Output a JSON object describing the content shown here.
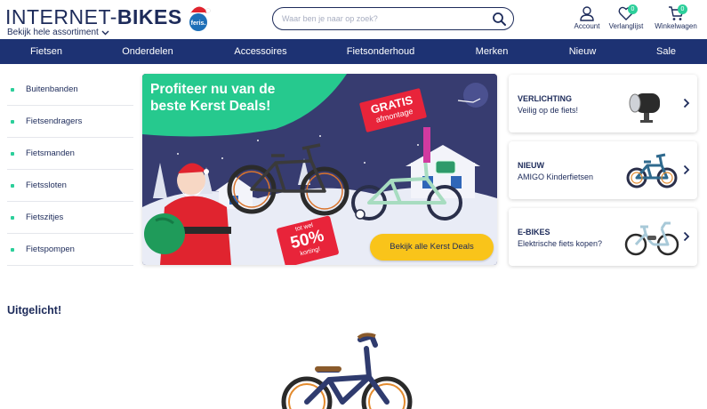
{
  "header": {
    "logo_light": "INTERNET-",
    "logo_bold": "BIKES",
    "feris_label": "feris.",
    "assortment_label": "Bekijk hele assortiment",
    "search": {
      "placeholder": "Waar ben je naar op zoek?"
    },
    "account_label": "Account",
    "wishlist_label": "Verlanglijst",
    "wishlist_count": "0",
    "cart_label": "Winkelwagen",
    "cart_count": "0"
  },
  "nav": {
    "items": [
      {
        "label": "Fietsen"
      },
      {
        "label": "Onderdelen"
      },
      {
        "label": "Accessoires"
      },
      {
        "label": "Fietsonderhoud"
      },
      {
        "label": "Merken"
      },
      {
        "label": "Nieuw"
      },
      {
        "label": "Sale"
      }
    ]
  },
  "sidebar": {
    "items": [
      {
        "label": "Buitenbanden"
      },
      {
        "label": "Fietsendragers"
      },
      {
        "label": "Fietsmanden"
      },
      {
        "label": "Fietssloten"
      },
      {
        "label": "Fietszitjes"
      },
      {
        "label": "Fietspompen"
      }
    ]
  },
  "banner": {
    "title": "Profiteer nu van de beste Kerst Deals!",
    "gratis_line1": "GRATIS",
    "gratis_line2": "afmontage",
    "discount_line1": "tot wel",
    "discount_line2": "50%",
    "discount_line3": "korting!",
    "cta_label": "Bekijk alle Kerst Deals"
  },
  "cards": [
    {
      "title": "VERLICHTING",
      "subtitle": "Veilig op de fiets!"
    },
    {
      "title": "NIEUW",
      "subtitle": "AMIGO Kinderfietsen"
    },
    {
      "title": "E-BIKES",
      "subtitle": "Elektrische fiets kopen?"
    }
  ],
  "featured": {
    "heading": "Uitgelicht!"
  },
  "colors": {
    "brand_navy": "#1d3273",
    "text_navy": "#1d2b5a",
    "accent_green": "#2ccf9a",
    "cta_yellow": "#f9c41a",
    "promo_red": "#e8243a"
  }
}
